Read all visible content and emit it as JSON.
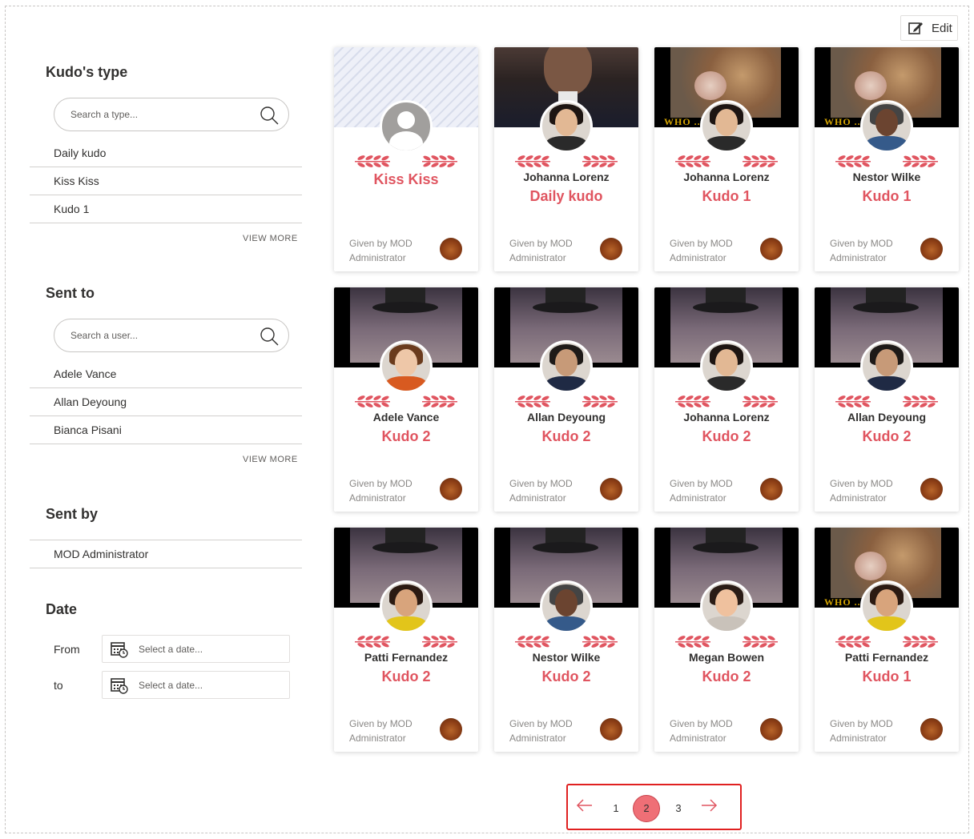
{
  "toolbar": {
    "edit_label": "Edit"
  },
  "filters": {
    "kudo_type": {
      "title": "Kudo's type",
      "search_placeholder": "Search a type...",
      "items": [
        "Daily kudo",
        "Kiss Kiss",
        "Kudo 1"
      ],
      "view_more": "VIEW MORE"
    },
    "sent_to": {
      "title": "Sent to",
      "search_placeholder": "Search a user...",
      "items": [
        "Adele Vance",
        "Allan Deyoung",
        "Bianca Pisani"
      ],
      "view_more": "VIEW MORE"
    },
    "sent_by": {
      "title": "Sent by",
      "items": [
        "MOD Administrator"
      ]
    },
    "date": {
      "title": "Date",
      "from_label": "From",
      "to_label": "to",
      "placeholder": "Select a date..."
    }
  },
  "cards": [
    {
      "recipient": "",
      "kudo": "Kiss Kiss",
      "given_by": "Given by MOD Administrator"
    },
    {
      "recipient": "Johanna Lorenz",
      "kudo": "Daily kudo",
      "given_by": "Given by MOD Administrator"
    },
    {
      "recipient": "Johanna Lorenz",
      "kudo": "Kudo 1",
      "given_by": "Given by MOD Administrator"
    },
    {
      "recipient": "Nestor Wilke",
      "kudo": "Kudo 1",
      "given_by": "Given by MOD Administrator"
    },
    {
      "recipient": "Adele Vance",
      "kudo": "Kudo 2",
      "given_by": "Given by MOD Administrator"
    },
    {
      "recipient": "Allan Deyoung",
      "kudo": "Kudo 2",
      "given_by": "Given by MOD Administrator"
    },
    {
      "recipient": "Johanna Lorenz",
      "kudo": "Kudo 2",
      "given_by": "Given by MOD Administrator"
    },
    {
      "recipient": "Allan Deyoung",
      "kudo": "Kudo 2",
      "given_by": "Given by MOD Administrator"
    },
    {
      "recipient": "Patti Fernandez",
      "kudo": "Kudo 2",
      "given_by": "Given by MOD Administrator"
    },
    {
      "recipient": "Nestor Wilke",
      "kudo": "Kudo 2",
      "given_by": "Given by MOD Administrator"
    },
    {
      "recipient": "Megan Bowen",
      "kudo": "Kudo 2",
      "given_by": "Given by MOD Administrator"
    },
    {
      "recipient": "Patti Fernandez",
      "kudo": "Kudo 1",
      "given_by": "Given by MOD Administrator"
    }
  ],
  "banner_text": "WHO ... ME?",
  "pagination": {
    "pages": [
      "1",
      "2",
      "3"
    ],
    "current": "2"
  },
  "colors": {
    "accent": "#e05560",
    "active_page": "#ef6f76",
    "highlight_border": "#e02020"
  }
}
